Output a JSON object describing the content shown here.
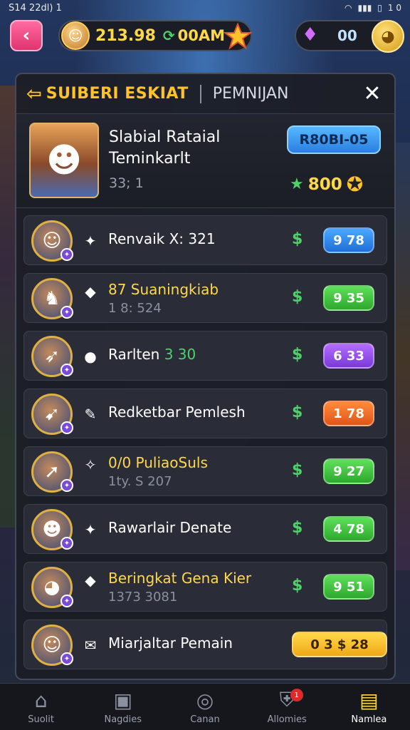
{
  "status": {
    "time": "S14 22dl) 1",
    "right": "1 0"
  },
  "topbar": {
    "currency_amount": "213.98",
    "time_value": "00AM",
    "right_value": "00"
  },
  "panel": {
    "title": "SUIBERI ESKIAT",
    "subtitle": "PEMNIJAN",
    "profile": {
      "name_line1": "Slabial Rataial",
      "name_line2": "Teminkarlt",
      "stat": "33; 1",
      "rank_label": "R80BI-05",
      "reward_value": "800"
    },
    "rows": [
      {
        "name": "Renvaik X: 321",
        "sub": "",
        "button": "9 78",
        "color": "blue",
        "avatar": "hero-1"
      },
      {
        "name": "87 Suaningkiab",
        "sub": "1 8: 524",
        "button": "9 35",
        "color": "green",
        "avatar": "knight"
      },
      {
        "name": "Rarlten",
        "extra": "3 30",
        "sub": "",
        "button": "6 33",
        "color": "purple",
        "avatar": "bow"
      },
      {
        "name": "Redketbar Pemlesh",
        "sub": "",
        "button": "1 78",
        "color": "orange",
        "avatar": "arrow"
      },
      {
        "name": "PuliaoSuls",
        "prefix": "0/0",
        "sub": "1ty. S 207",
        "button": "9 27",
        "color": "green",
        "avatar": "spear"
      },
      {
        "name": "Rawarlair Denate",
        "sub": "",
        "button": "4 78",
        "color": "green",
        "avatar": "hero-2"
      },
      {
        "name": "Beringkat Gena Kier",
        "sub": "1373 3081",
        "button": "9 51",
        "color": "green",
        "avatar": "mask"
      },
      {
        "name": "Miarjaltar Pemain",
        "sub": "",
        "button": "0 3 $ 28",
        "color": "gold",
        "avatar": "hero-3"
      }
    ]
  },
  "nav": [
    {
      "label": "Suolit",
      "icon": "home-icon",
      "glyph": "⌂"
    },
    {
      "label": "Nagdies",
      "icon": "chest-icon",
      "glyph": "▣"
    },
    {
      "label": "Canan",
      "icon": "target-icon",
      "glyph": "◎"
    },
    {
      "label": "Allomies",
      "icon": "shield-icon",
      "glyph": "⛨",
      "badge": "1"
    },
    {
      "label": "Namlea",
      "icon": "map-icon",
      "glyph": "▤",
      "active": true
    }
  ]
}
